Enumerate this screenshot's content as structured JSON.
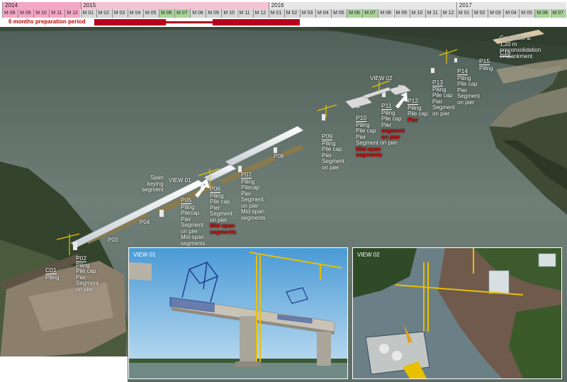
{
  "timeline": {
    "years": [
      {
        "label": "2014",
        "start": 0
      },
      {
        "label": "2015",
        "start": 5
      },
      {
        "label": "2016",
        "start": 17
      },
      {
        "label": "2017",
        "start": 29
      }
    ],
    "months": [
      "M 08",
      "M 09",
      "M 10",
      "M 11",
      "M 12",
      "M 01",
      "M 02",
      "M 03",
      "M 04",
      "M 05",
      "M 06",
      "M 07",
      "M 08",
      "M 09",
      "M 10",
      "M 11",
      "M 12",
      "M 01",
      "M 02",
      "M 03",
      "M 04",
      "M 05",
      "M 06",
      "M 07",
      "M 08",
      "M 09",
      "M 10",
      "M 11",
      "M 12",
      "M 01",
      "M 02",
      "M 03",
      "M 04",
      "M 05",
      "M 06",
      "M 07"
    ],
    "highlight_colors": {
      "pink": "#f4a7c3",
      "green": "#a9d49a",
      "grey": "#d6d6d6"
    },
    "prep_label": "6 months preparation period",
    "bar_color": "#b8001f"
  },
  "labels": {
    "c16": {
      "name": "C16",
      "lines": [
        "Geotextile &",
        "1,20 m",
        "preconsolidation",
        "embankment"
      ]
    },
    "p15": {
      "name": "P15",
      "lines": [
        "Piling"
      ]
    },
    "p14": {
      "name": "P14",
      "lines": [
        "Piling",
        "Pile cap",
        "Pier",
        "Segment",
        "on pier"
      ]
    },
    "p13": {
      "name": "P13",
      "lines": [
        "Piling",
        "Pile cap",
        "Pier",
        "Segment",
        "on pier"
      ]
    },
    "p12": {
      "name": "P12",
      "lines": [
        "Piling",
        "Pile cap"
      ],
      "red": [
        "Pier"
      ]
    },
    "p11": {
      "name": "P11",
      "lines": [
        "Piling",
        "Pile cap",
        "Pier"
      ],
      "red": [
        "segment",
        "on pier"
      ]
    },
    "p10": {
      "name": "P10",
      "lines": [
        "Piling",
        "Pile cap",
        "Pier",
        "Segment on pier"
      ],
      "red": [
        "Mid-span",
        "segments"
      ]
    },
    "p09": {
      "name": "P09",
      "lines": [
        "Piling",
        "Pile cap",
        "Pier",
        "Segment",
        "on pier"
      ]
    },
    "p08": {
      "name": "P08"
    },
    "p07": {
      "name": "P07",
      "lines": [
        "Piling",
        "Pilecap",
        "Pier",
        "Segment",
        "on pier",
        "Mid-span",
        "segments"
      ]
    },
    "p06": {
      "name": "P06",
      "lines": [
        "Piling",
        "Pile cap",
        "Pier",
        "Segment",
        "on pier"
      ],
      "red": [
        "Mid-span",
        "segments"
      ]
    },
    "p05": {
      "name": "P05",
      "lines": [
        "Piling",
        "Pilecap",
        "Pier",
        "Segment",
        "on pier",
        "Mid-span",
        "segments"
      ]
    },
    "p04": {
      "name": "P04"
    },
    "p03": {
      "name": "P03"
    },
    "p02": {
      "name": "P02",
      "lines": [
        "Piling",
        "Pile cap",
        "Pier",
        "Segment",
        "on pier"
      ]
    },
    "c01": {
      "name": "C01",
      "lines": [
        "Piling"
      ]
    },
    "span_keying": {
      "lines": [
        "Span",
        "keying",
        "segment"
      ]
    },
    "view01_tag": "VIEW 01",
    "view02_tag": "VIEW 02"
  },
  "insets": {
    "view01": "VIEW 01",
    "view02": "VIEW 02"
  }
}
